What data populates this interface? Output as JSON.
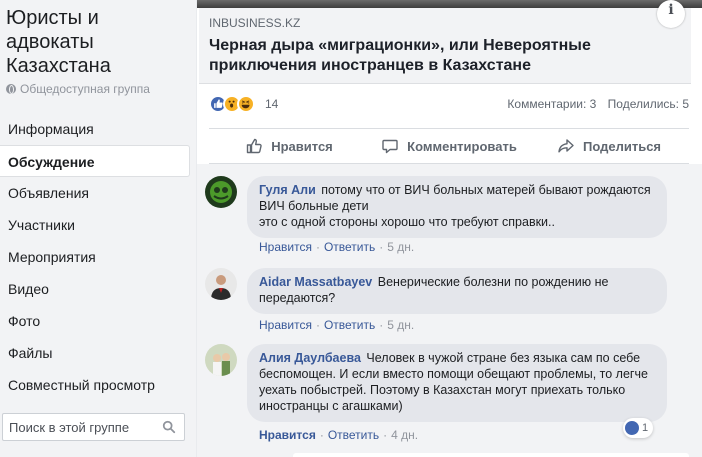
{
  "sidebar": {
    "group_title": "Юристы и адвокаты Казахстана",
    "group_type": "Общедоступная группа",
    "nav": [
      {
        "label": "Информация",
        "active": false
      },
      {
        "label": "Обсуждение",
        "active": true
      },
      {
        "label": "Объявления",
        "active": false
      },
      {
        "label": "Участники",
        "active": false
      },
      {
        "label": "Мероприятия",
        "active": false
      },
      {
        "label": "Видео",
        "active": false
      },
      {
        "label": "Фото",
        "active": false
      },
      {
        "label": "Файлы",
        "active": false
      },
      {
        "label": "Совместный просмотр",
        "active": false
      }
    ],
    "search_placeholder": "Поиск в этой группе"
  },
  "post": {
    "info_icon": "i",
    "link_domain": "INBUSINESS.KZ",
    "link_title": "Черная дыра «миграционки», или Невероятные приключения иностранцев в Казахстане",
    "reaction_count": "14",
    "comments_count": "Комментарии: 3",
    "shares_count": "Поделились: 5",
    "actions": {
      "like": "Нравится",
      "comment": "Комментировать",
      "share": "Поделиться"
    }
  },
  "comments": [
    {
      "author": "Гуля Али",
      "text": "потому что от ВИЧ больных матерей бывают рождаются ВИЧ больные дети",
      "text2": "это с одной стороны хорошо что требуют справки..",
      "like": "Нравится",
      "reply": "Ответить",
      "time": "5 дн."
    },
    {
      "author": "Aidar Massatbayev",
      "text": "Венерические болезни по рождению не передаются?",
      "like": "Нравится",
      "reply": "Ответить",
      "time": "5 дн."
    },
    {
      "author": "Алия Даулбаева",
      "text": "Человек в чужой стране без языка сам по себе беспомощен. И если вместо помощи обещают проблемы, то легче уехать побыстрей. Поэтому в Казахстан могут приехать только иностранцы с агашками)",
      "like": "Нравится",
      "reply": "Ответить",
      "time": "4 дн.",
      "reactions": "1"
    }
  ],
  "colors": {
    "link_blue": "#385898",
    "like_blue": "#4267b2",
    "bubble_gray": "#e4e6eb",
    "sidebar_bg": "#f2f3f5"
  },
  "icons": {
    "globe": "globe-icon",
    "search": "search-icon",
    "like": "thumbs-up-icon",
    "comment": "comment-icon",
    "share": "share-icon"
  }
}
